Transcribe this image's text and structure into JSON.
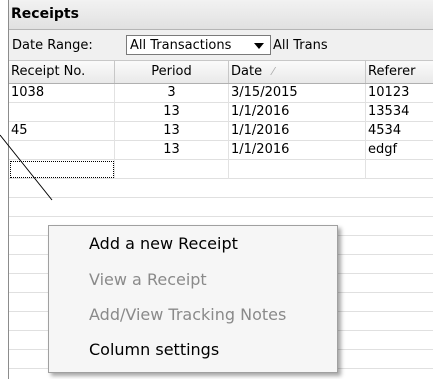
{
  "panel": {
    "title": "Receipts"
  },
  "filter": {
    "label": "Date Range:",
    "selected": "All Transactions",
    "trailing_text": "All Trans"
  },
  "grid": {
    "columns": [
      "Receipt No.",
      "Period",
      "Date",
      "Referer"
    ],
    "rows": [
      [
        "1038",
        "3",
        "3/15/2015",
        "10123"
      ],
      [
        "",
        "13",
        "1/1/2016",
        "13534"
      ],
      [
        "45",
        "13",
        "1/1/2016",
        "4534"
      ],
      [
        "",
        "13",
        "1/1/2016",
        "edgf"
      ],
      [
        "",
        "",
        "",
        ""
      ]
    ],
    "sorted_column_icon": "sort-ascending-icon"
  },
  "context_menu": {
    "items": [
      {
        "label": "Add a new Receipt",
        "enabled": true
      },
      {
        "label": "View a Receipt",
        "enabled": false
      },
      {
        "label": "Add/View Tracking Notes",
        "enabled": false
      },
      {
        "label": "Column settings",
        "enabled": true
      }
    ]
  }
}
